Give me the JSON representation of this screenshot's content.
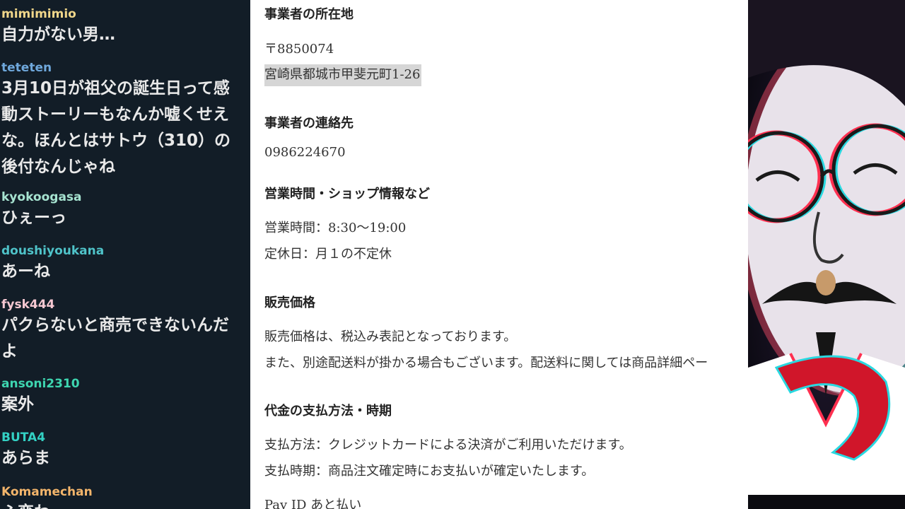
{
  "chat": {
    "messages": [
      {
        "user": "mimimimio",
        "user_color": "#f0d68a",
        "text": "自力がない男…"
      },
      {
        "user": "teteten",
        "user_color": "#6fa8dc",
        "text": "3月10日が祖父の誕生日って感\n動ストーリーもなんか嘘くせえ\nな。ほんとはサトウ（310）の\n後付なんじゃね"
      },
      {
        "user": "kyokoogasa",
        "user_color": "#a6e3d0",
        "text": "ひぇーっ"
      },
      {
        "user": "doushiyoukana",
        "user_color": "#4fc3c9",
        "text": "あーね"
      },
      {
        "user": "fysk444",
        "user_color": "#f6c8d2",
        "text": "パクらないと商売できないんだ\nよ"
      },
      {
        "user": "ansoni2310",
        "user_color": "#3ed6b0",
        "text": "案外"
      },
      {
        "user": "BUTA4",
        "user_color": "#33d1c4",
        "text": "あらま"
      },
      {
        "user": "Komamechan",
        "user_color": "#f3b56b",
        "text": "ふ変わ"
      }
    ]
  },
  "doc": {
    "location_heading": "事業者の所在地",
    "postal": "〒8850074",
    "address": "宮崎県都城市甲斐元町1-26",
    "contact_heading": "事業者の連絡先",
    "phone": "0986224670",
    "hours_heading": "営業時間・ショップ情報など",
    "hours": "営業時間：8:30～19:00",
    "holiday": "定休日：月１の不定休",
    "price_heading": "販売価格",
    "price_line1": "販売価格は、税込み表記となっております。",
    "price_line2": "また、別途配送料が掛かる場合もございます。配送料に関しては商品詳細ペー",
    "payment_heading": "代金の支払方法・時期",
    "payment_method": "支払方法：クレジットカードによる決済がご利用いただけます。",
    "payment_time": "支払時期：商品注文確定時にお支払いが確定いたします。",
    "payid": "Pay ID あと払い"
  },
  "portrait": {
    "icon": "avatar-face-icon",
    "accent": "#d0162a"
  }
}
